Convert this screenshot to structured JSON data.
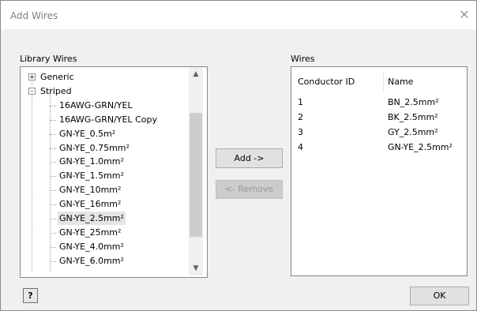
{
  "dialog": {
    "title": "Add Wires"
  },
  "library": {
    "label": "Library Wires",
    "nodes": [
      {
        "label": "Generic",
        "level": 0,
        "expander": "+"
      },
      {
        "label": "Striped",
        "level": 0,
        "expander": "-"
      },
      {
        "label": "16AWG-GRN/YEL",
        "level": 1
      },
      {
        "label": "16AWG-GRN/YEL Copy",
        "level": 1
      },
      {
        "label": "GN-YE_0.5m²",
        "level": 1
      },
      {
        "label": "GN-YE_0.75mm²",
        "level": 1
      },
      {
        "label": "GN-YE_1.0mm²",
        "level": 1
      },
      {
        "label": "GN-YE_1.5mm²",
        "level": 1
      },
      {
        "label": "GN-YE_10mm²",
        "level": 1
      },
      {
        "label": "GN-YE_16mm²",
        "level": 1
      },
      {
        "label": "GN-YE_2.5mm²",
        "level": 1,
        "selected": true
      },
      {
        "label": "GN-YE_25mm²",
        "level": 1
      },
      {
        "label": "GN-YE_4.0mm²",
        "level": 1
      },
      {
        "label": "GN-YE_6.0mm²",
        "level": 1
      }
    ]
  },
  "buttons": {
    "add": "Add ->",
    "remove": "<- Remove",
    "ok": "OK",
    "help": "?"
  },
  "wires": {
    "label": "Wires",
    "columns": [
      "Conductor ID",
      "Name"
    ],
    "rows": [
      [
        "1",
        "BN_2.5mm²"
      ],
      [
        "2",
        "BK_2.5mm²"
      ],
      [
        "3",
        "GY_2.5mm²"
      ],
      [
        "4",
        "GN-YE_2.5mm²"
      ]
    ]
  },
  "icons": {
    "close": "close-icon",
    "help": "help-icon",
    "scroll_up": "scroll-up-icon",
    "scroll_down": "scroll-down-icon"
  }
}
